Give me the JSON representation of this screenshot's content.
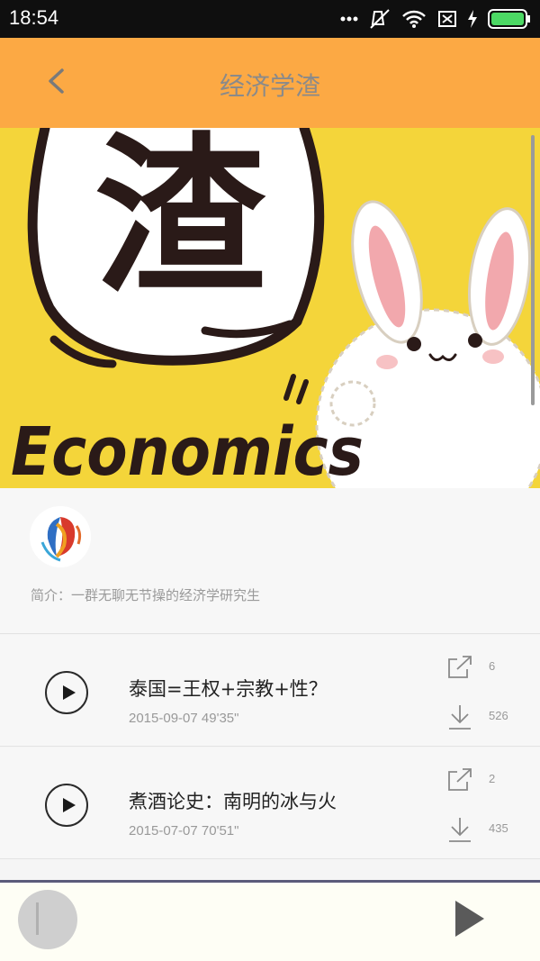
{
  "status_bar": {
    "time": "18:54",
    "icons": [
      "dots-icon",
      "mute-icon",
      "wifi-icon",
      "no-sim-icon",
      "charging-icon",
      "battery-icon"
    ]
  },
  "app_bar": {
    "title": "经济学渣",
    "back_icon": "chevron-left-icon"
  },
  "banner": {
    "logo_char": "渣",
    "word": "Economics",
    "colors": {
      "background": "#f4d53a",
      "ink": "#2a1a18"
    }
  },
  "profile": {
    "intro": "简介：一群无聊无节操的经济学研究生"
  },
  "episodes": [
    {
      "title": "泰国=王权+宗教+性？",
      "date": "2015-09-07",
      "duration": "49'35\"",
      "share_count": "6",
      "download_count": "526"
    },
    {
      "title": "煮酒论史：南明的冰与火",
      "date": "2015-07-07",
      "duration": "70'51\"",
      "share_count": "2",
      "download_count": "435"
    }
  ],
  "player": {
    "play_icon": "play-icon"
  },
  "colors": {
    "accent": "#fca944",
    "status_bar": "#0f0f0f",
    "battery": "#4cd964"
  }
}
